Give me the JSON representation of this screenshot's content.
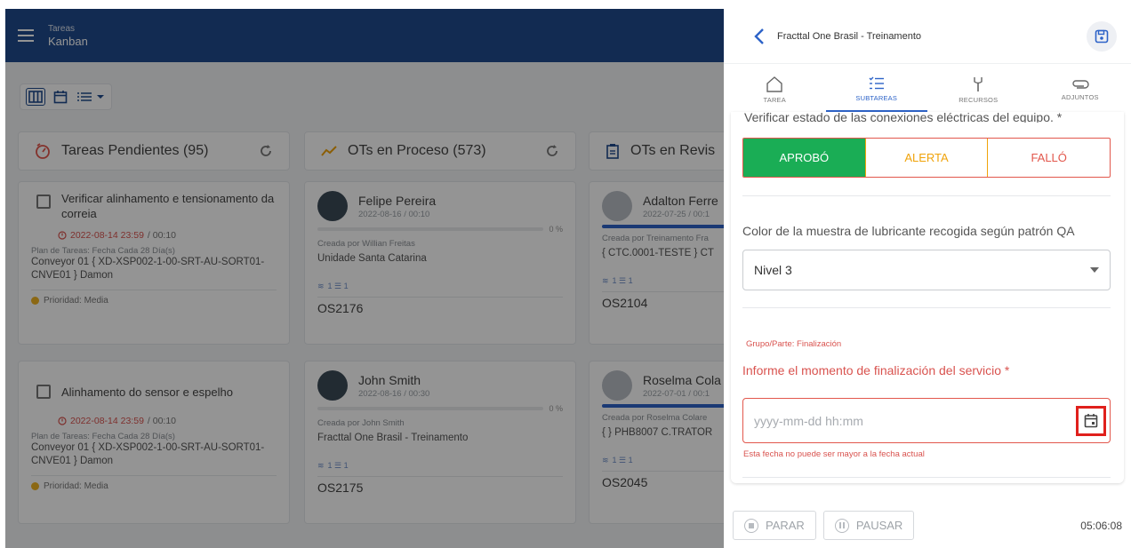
{
  "kanban": {
    "header": {
      "breadcrumb": "Tareas",
      "title": "Kanban"
    },
    "columns": [
      {
        "title": "Tareas Pendientes (95)",
        "cards": [
          {
            "title": "Verificar alinhamento e tensionamento da correia",
            "date": "2022-08-14 23:59",
            "time": "/ 00:10",
            "plan": "Plan de Tareas: Fecha Cada 28 Día(s)",
            "asset": "Conveyor 01 { XD-XSP002-1-00-SRT-AU-SORT01-CNVE01 } Damon",
            "priority": "Prioridad: Media"
          },
          {
            "title": "Alinhamento do sensor e espelho",
            "date": "2022-08-14 23:59",
            "time": "/ 00:10",
            "plan": "Plan de Tareas: Fecha Cada 28 Día(s)",
            "asset": "Conveyor 01 { XD-XSP002-1-00-SRT-AU-SORT01-CNVE01 } Damon",
            "priority": "Prioridad: Media"
          }
        ]
      },
      {
        "title": "OTs en Proceso (573)",
        "cards": [
          {
            "user": "Felipe Pereira",
            "date": "2022-08-16 / 00:10",
            "progress": "0 %",
            "created_by": "Creada por Willian Freitas",
            "location": "Unidade Santa Catarina",
            "counts": "1 ☰ 1",
            "code": "OS2176"
          },
          {
            "user": "John Smith",
            "date": "2022-08-16 / 00:30",
            "progress": "0 %",
            "created_by": "Creada por John Smith",
            "location": "Fracttal One Brasil - Treinamento",
            "counts": "1 ☰ 1",
            "code": "OS2175"
          }
        ]
      },
      {
        "title": "OTs en Revis",
        "cards": [
          {
            "user": "Adalton Ferre",
            "date": "2022-07-25 / 00:1",
            "created_by": "Creada por Treinamento Fra",
            "location": "{ CTC.0001-TESTE } CT",
            "counts": "1 ☰ 1",
            "code": "OS2104"
          },
          {
            "user": "Roselma Cola",
            "date": "2022-07-01 / 00:1",
            "created_by": "Creada por Roselma Colare",
            "location": "{ } PHB8007 C.TRATOR",
            "counts": "1 ☰ 1",
            "code": "OS2045"
          }
        ]
      }
    ]
  },
  "panel": {
    "title": "Fracttal One Brasil - Treinamento",
    "tabs": [
      {
        "label": "TAREA",
        "icon": "home-icon"
      },
      {
        "label": "SUBTAREAS",
        "icon": "checklist-icon",
        "active": true
      },
      {
        "label": "RECURSOS",
        "icon": "tools-icon"
      },
      {
        "label": "ADJUNTOS",
        "icon": "paperclip-icon"
      }
    ],
    "cut_label": "Verificar estado de las conexiones eléctricas del equipo. *",
    "segmented": {
      "ok": "APROBÓ",
      "warn": "ALERTA",
      "fail": "FALLÓ"
    },
    "question1": "Color de la muestra de lubricante recogida según patrón QA",
    "select_value": "Nivel 3",
    "group_label": "Grupo/Parte: Finalización",
    "question2": "Informe el momento de finalización del servicio *",
    "date_placeholder": "yyyy-mm-dd hh:mm",
    "error_text": "Esta fecha no puede ser mayor a la fecha actual"
  },
  "footer": {
    "stop": "PARAR",
    "pause": "PAUSAR",
    "timer": "05:06:08"
  },
  "colors": {
    "header_blue": "#1f4a8d",
    "accent": "#2d63c8",
    "ok_green": "#1aad55",
    "warn_orange": "#f0a30a",
    "error_red": "#e2574c",
    "highlight_red": "#e0201c"
  }
}
